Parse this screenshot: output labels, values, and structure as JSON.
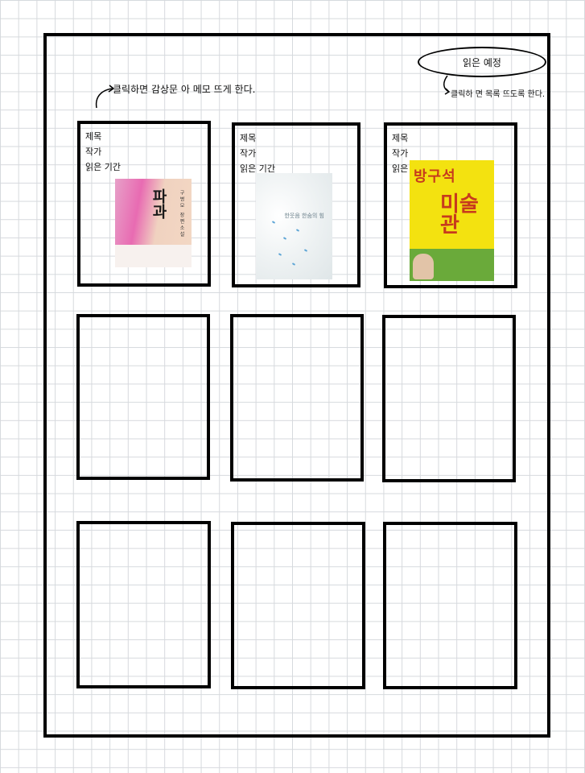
{
  "top_button": {
    "label": "읽은 예정"
  },
  "notes": {
    "click_review": "클릭하면 감상문 아 메모 뜨게 한다.",
    "click_list": "클릭하 면 목록 뜨도록 한다."
  },
  "cards": [
    {
      "title": "제목",
      "author": "작가",
      "period": "읽은 기간",
      "cover": "cover-1"
    },
    {
      "title": "제목",
      "author": "작가",
      "period": "읽은 기간",
      "cover": "cover-2"
    },
    {
      "title": "제목",
      "author": "작가",
      "period": "읽은 기간",
      "cover": "cover-3"
    }
  ],
  "covers": {
    "c1": {
      "title": "파과",
      "subtitle": "구병모 장편소설"
    },
    "c2": {
      "title": "한웃음 한숨의 힘"
    },
    "c3": {
      "title_top": "방구석",
      "title_bottom": "미술관"
    }
  }
}
